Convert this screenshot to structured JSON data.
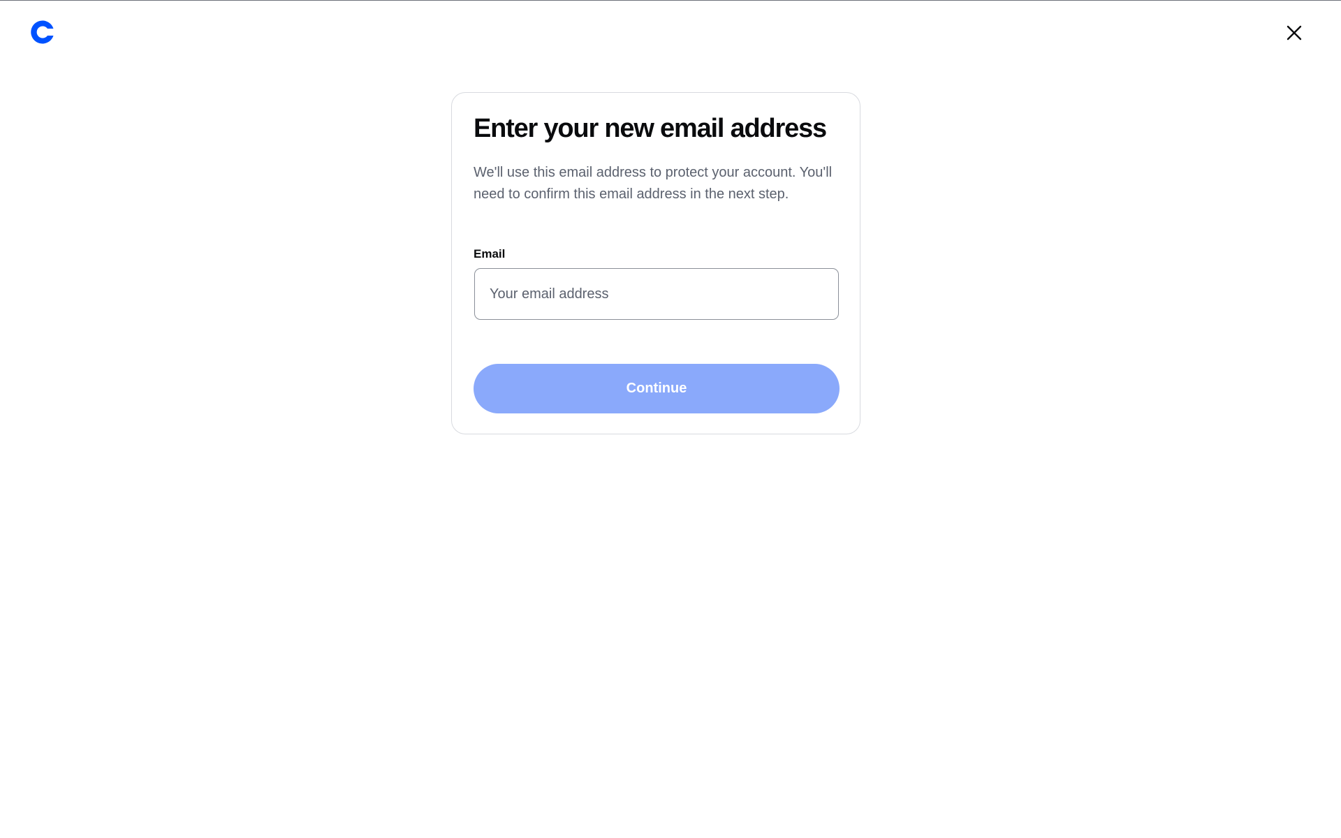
{
  "header": {
    "logo_icon": "coinbase-logo-icon",
    "close_icon": "close-icon",
    "brand_color": "#0052ff"
  },
  "card": {
    "title": "Enter your new email address",
    "description": "We'll use this email address to protect your account. You'll need to confirm this email address in the next step.",
    "email_label": "Email",
    "email_value": "",
    "email_placeholder": "Your email address",
    "continue_label": "Continue",
    "continue_color": "#8aa9fb"
  }
}
